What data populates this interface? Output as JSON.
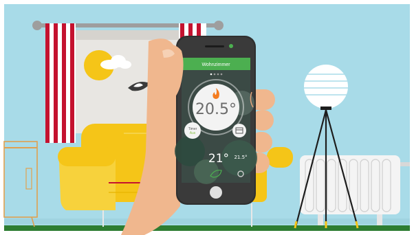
{
  "app": {
    "room_title": "Wohnzimmer",
    "pager_dots": 4,
    "active_dot": 1,
    "target_temperature": "20.5°",
    "timer_label": "Timer",
    "timer_state": "Aus",
    "current_temperature": "21°",
    "setpoint_temperature": "21.5°",
    "accent_color": "#4caf50",
    "flame_color": "#f47c20"
  },
  "scene": {
    "sky_color": "#a8dbe8",
    "floor_color": "#2e7d32",
    "sofa_color": "#f5c518",
    "curtain_color": "#c4122f",
    "skin_color": "#f0b78e",
    "icons": [
      "sun-icon",
      "cloud-icon",
      "bird-icon",
      "flame-icon",
      "calendar-icon",
      "leaf-icon",
      "settings-icon"
    ]
  }
}
